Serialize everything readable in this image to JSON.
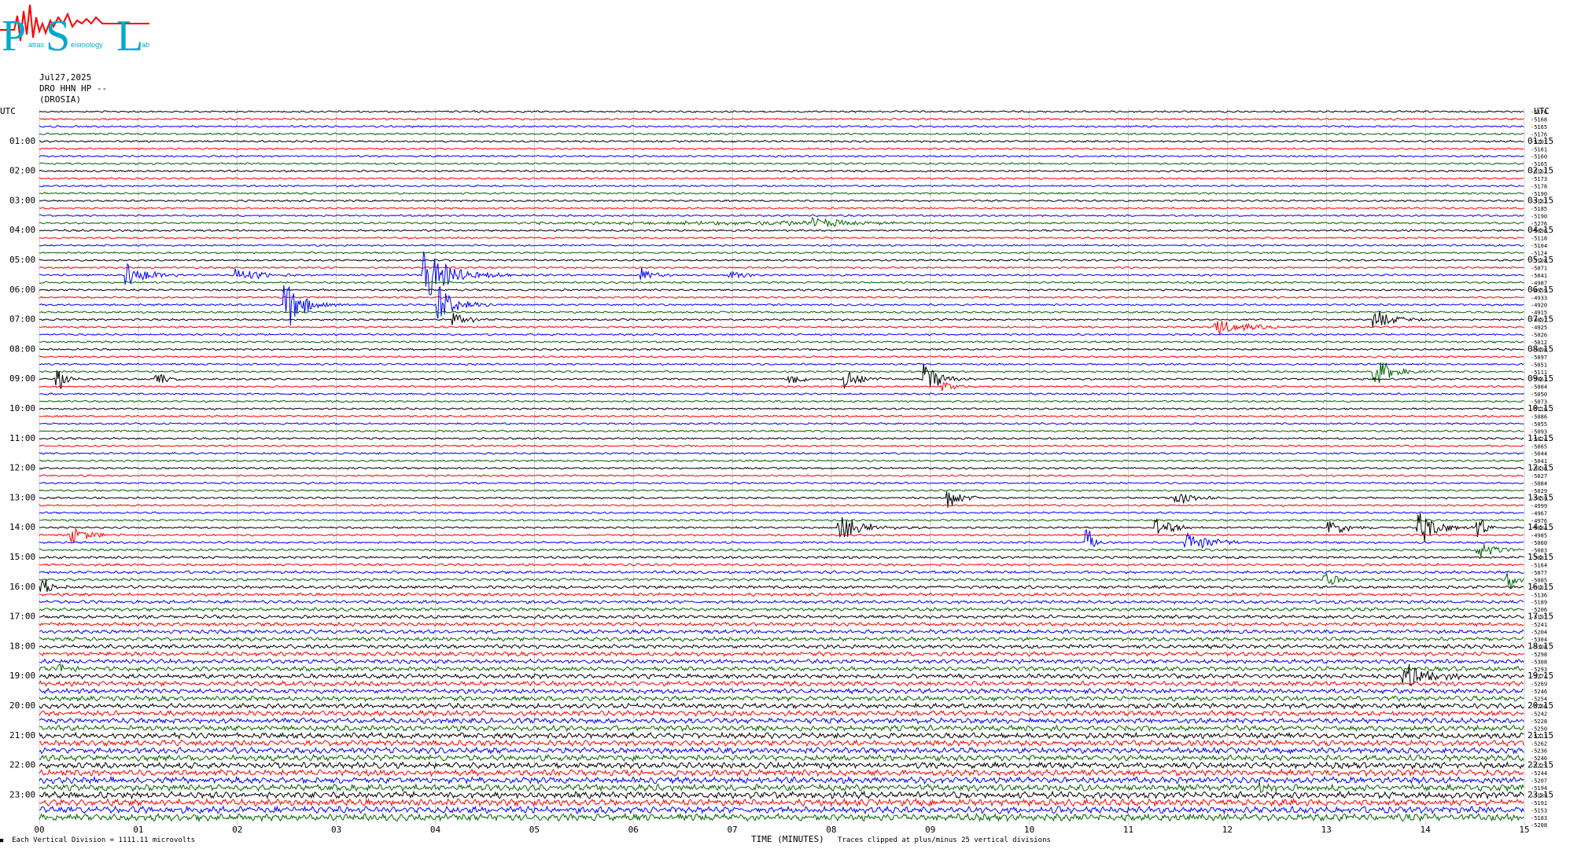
{
  "header": {
    "date": "Jul27,2025",
    "station_line": "DRO HHN HP --",
    "station_name": "(DROSIA)"
  },
  "logo": {
    "letters": [
      "P",
      "S",
      "L"
    ],
    "subtext": [
      "atras",
      "eismology",
      "ab"
    ]
  },
  "footer": {
    "division": "Each Vertical Division = 1111.11 microvolts",
    "xlabel": "TIME (MINUTES)",
    "clip_note": "Traces clipped at plus/minus 25 vertical divisions"
  },
  "colors": {
    "trace_cycle": [
      "#000000",
      "#ff0000",
      "#0000ff",
      "#006400"
    ],
    "logo_accent": "#00aacc",
    "logo_red": "#ff0000"
  },
  "chart_data": {
    "type": "line",
    "title": "",
    "xlabel": "TIME (MINUTES)",
    "ylabel": "",
    "xlim": [
      0,
      15
    ],
    "x_ticks": [
      "00",
      "01",
      "02",
      "03",
      "04",
      "05",
      "06",
      "07",
      "08",
      "09",
      "10",
      "11",
      "12",
      "13",
      "14",
      "15"
    ],
    "left_axis_label": "UTC",
    "right_axis_label": "UTC",
    "left_time_labels": [
      "01:00",
      "02:00",
      "03:00",
      "04:00",
      "05:00",
      "06:00",
      "07:00",
      "08:00",
      "09:00",
      "10:00",
      "11:00",
      "12:00",
      "13:00",
      "14:00",
      "15:00",
      "16:00",
      "17:00",
      "18:00",
      "19:00",
      "20:00",
      "21:00",
      "22:00",
      "23:00"
    ],
    "right_time_labels": [
      "01:15",
      "02:15",
      "03:15",
      "04:15",
      "05:15",
      "06:15",
      "07:15",
      "08:15",
      "09:15",
      "10:15",
      "11:15",
      "12:15",
      "13:15",
      "14:15",
      "15:15",
      "16:15",
      "17:15",
      "18:15",
      "19:15",
      "20:15",
      "21:15",
      "22:15",
      "23:15"
    ],
    "traces_per_hour": 4,
    "trace_count": 96,
    "offsets": [
      -5176,
      -5168,
      -5165,
      -5176,
      -5201,
      -5161,
      -5160,
      -5165,
      -5162,
      -5173,
      -5178,
      -5190,
      -5182,
      -5185,
      -5190,
      -5276,
      -5096,
      -5118,
      -5104,
      -5124,
      -5108,
      -5071,
      -5041,
      -4987,
      -4959,
      -4933,
      -4920,
      -4915,
      -4897,
      -4925,
      -5026,
      -5012,
      -5098,
      -5097,
      -5051,
      -5111,
      -5063,
      -5084,
      -5050,
      -5073,
      -5116,
      -5086,
      -5055,
      -5093,
      -5024,
      -5065,
      -5044,
      -5041,
      -5036,
      -5027,
      -5084,
      -5029,
      -5059,
      -4999,
      -4967,
      -4976,
      -5084,
      -4985,
      -5060,
      -5083,
      -5081,
      -5164,
      -5077,
      -5085,
      -5161,
      -5136,
      -5189,
      -5206,
      -5197,
      -5241,
      -5204,
      -5304,
      -5308,
      -5298,
      -5308,
      -5293,
      -5274,
      -5269,
      -5246,
      -5254,
      -5266,
      -5242,
      -5228,
      -5250,
      -5213,
      -5262,
      -5236,
      -5246,
      -5225,
      -5244,
      -5207,
      -5194,
      -5189,
      -5191,
      -5153,
      -5183
    ],
    "extra_offset_bottom": "-5208",
    "events": [
      {
        "trace": 15,
        "minute": 7.8,
        "amp": 7,
        "width": 0.9,
        "pre": 4.0
      },
      {
        "trace": 22,
        "minute": 0.9,
        "amp": 14,
        "width": 0.4
      },
      {
        "trace": 22,
        "minute": 2.0,
        "amp": 10,
        "width": 0.5
      },
      {
        "trace": 22,
        "minute": 3.9,
        "amp": 30,
        "width": 0.6
      },
      {
        "trace": 22,
        "minute": 6.1,
        "amp": 10,
        "width": 0.2
      },
      {
        "trace": 22,
        "minute": 7.0,
        "amp": 5,
        "width": 0.3
      },
      {
        "trace": 26,
        "minute": 2.5,
        "amp": 34,
        "width": 0.35
      },
      {
        "trace": 26,
        "minute": 4.05,
        "amp": 24,
        "width": 0.35
      },
      {
        "trace": 28,
        "minute": 4.2,
        "amp": 8,
        "width": 0.3
      },
      {
        "trace": 28,
        "minute": 13.5,
        "amp": 12,
        "width": 0.4
      },
      {
        "trace": 29,
        "minute": 11.9,
        "amp": 10,
        "width": 0.6
      },
      {
        "trace": 36,
        "minute": 0.2,
        "amp": 16,
        "width": 0.15
      },
      {
        "trace": 36,
        "minute": 1.2,
        "amp": 8,
        "width": 0.25
      },
      {
        "trace": 36,
        "minute": 7.6,
        "amp": 6,
        "width": 0.3
      },
      {
        "trace": 36,
        "minute": 8.15,
        "amp": 14,
        "width": 0.3
      },
      {
        "trace": 36,
        "minute": 8.95,
        "amp": 22,
        "width": 0.3
      },
      {
        "trace": 37,
        "minute": 9.15,
        "amp": 6,
        "width": 0.3
      },
      {
        "trace": 35,
        "minute": 13.5,
        "amp": 18,
        "width": 0.35
      },
      {
        "trace": 52,
        "minute": 9.2,
        "amp": 14,
        "width": 0.25
      },
      {
        "trace": 52,
        "minute": 11.5,
        "amp": 12,
        "width": 0.3
      },
      {
        "trace": 56,
        "minute": 8.1,
        "amp": 16,
        "width": 0.5
      },
      {
        "trace": 56,
        "minute": 11.3,
        "amp": 12,
        "width": 0.4
      },
      {
        "trace": 56,
        "minute": 13.05,
        "amp": 10,
        "width": 0.4
      },
      {
        "trace": 56,
        "minute": 13.95,
        "amp": 22,
        "width": 0.35
      },
      {
        "trace": 56,
        "minute": 14.55,
        "amp": 16,
        "width": 0.15
      },
      {
        "trace": 57,
        "minute": 0.35,
        "amp": 10,
        "width": 0.4
      },
      {
        "trace": 58,
        "minute": 11.6,
        "amp": 14,
        "width": 0.5
      },
      {
        "trace": 58,
        "minute": 10.6,
        "amp": 18,
        "width": 0.1
      },
      {
        "trace": 59,
        "minute": 14.55,
        "amp": 10,
        "width": 0.4
      },
      {
        "trace": 63,
        "minute": 13.0,
        "amp": 10,
        "width": 0.25
      },
      {
        "trace": 63,
        "minute": 14.85,
        "amp": 10,
        "width": 0.3
      },
      {
        "trace": 64,
        "minute": 0.05,
        "amp": 12,
        "width": 0.2
      },
      {
        "trace": 76,
        "minute": 13.8,
        "amp": 16,
        "width": 0.6
      },
      {
        "trace": 75,
        "minute": 0.2,
        "amp": 6,
        "width": 0.2
      },
      {
        "trace": 91,
        "minute": 12.35,
        "amp": 6,
        "width": 0.3
      }
    ]
  }
}
